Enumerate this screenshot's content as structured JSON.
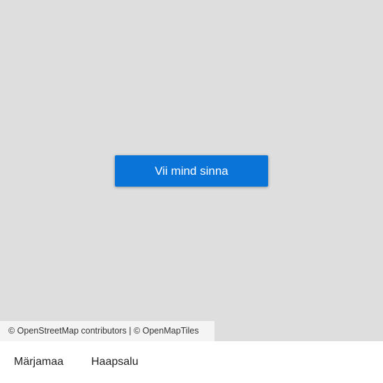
{
  "map": {
    "background_color": "#dedede",
    "button_label": "Vii mind sinna",
    "button_color": "#0a74d9",
    "attribution": {
      "osm_text": "© OpenStreetMap contributors",
      "separator": "|",
      "tiles_text": "© OpenMapTiles"
    }
  },
  "places": [
    {
      "label": "Märjamaa"
    },
    {
      "label": "Haapsalu"
    }
  ]
}
